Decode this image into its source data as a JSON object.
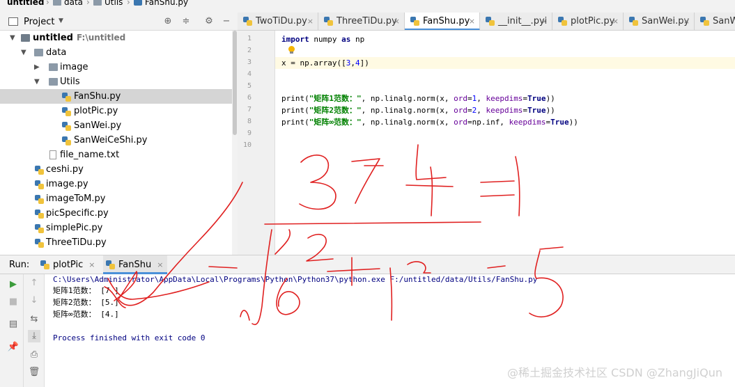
{
  "breadcrumb": [
    {
      "label": "untitled",
      "icon": "folder-icon",
      "bold": true
    },
    {
      "label": "data",
      "icon": "folder-icon"
    },
    {
      "label": "Utils",
      "icon": "folder-icon"
    },
    {
      "label": "FanShu.py",
      "icon": "python-file-icon"
    }
  ],
  "project": {
    "title": "Project",
    "tree": [
      {
        "label": "untitled",
        "path": "F:\\untitled",
        "type": "folder",
        "depth": 0,
        "expanded": true
      },
      {
        "label": "data",
        "type": "folder",
        "depth": 1,
        "expanded": true
      },
      {
        "label": "image",
        "type": "folder",
        "depth": 2,
        "expanded": false
      },
      {
        "label": "Utils",
        "type": "folder",
        "depth": 2,
        "expanded": true
      },
      {
        "label": "FanShu.py",
        "type": "py",
        "depth": 3,
        "selected": true
      },
      {
        "label": "plotPic.py",
        "type": "py",
        "depth": 3
      },
      {
        "label": "SanWei.py",
        "type": "py",
        "depth": 3
      },
      {
        "label": "SanWeiCeShi.py",
        "type": "py",
        "depth": 3
      },
      {
        "label": "file_name.txt",
        "type": "txt",
        "depth": 2
      },
      {
        "label": "ceshi.py",
        "type": "py",
        "depth": 1
      },
      {
        "label": "image.py",
        "type": "py",
        "depth": 1
      },
      {
        "label": "imageToM.py",
        "type": "py",
        "depth": 1
      },
      {
        "label": "picSpecific.py",
        "type": "py",
        "depth": 1
      },
      {
        "label": "simplePic.py",
        "type": "py",
        "depth": 1
      },
      {
        "label": "ThreeTiDu.py",
        "type": "py",
        "depth": 1
      }
    ]
  },
  "editor_tabs": [
    {
      "label": "TwoTiDu.py"
    },
    {
      "label": "ThreeTiDu.py"
    },
    {
      "label": "FanShu.py",
      "active": true
    },
    {
      "label": "__init__.pyi"
    },
    {
      "label": "plotPic.py"
    },
    {
      "label": "SanWei.py"
    },
    {
      "label": "SanW"
    }
  ],
  "editor": {
    "line_numbers": [
      "1",
      "2",
      "3",
      "4",
      "5",
      "6",
      "7",
      "8",
      "9",
      "10"
    ],
    "lines": {
      "l1_kw1": "import",
      "l1_mod": " numpy ",
      "l1_kw2": "as",
      "l1_alias": " np",
      "l3_a": "x = np.array([",
      "l3_n1": "3",
      "l3_comma": ",",
      "l3_n2": "4",
      "l3_b": "])",
      "l6_a": "print(",
      "l6_str": "\"矩阵1范数：\"",
      "l6_b": ", np.linalg.norm(x, ",
      "l6_p1": "ord",
      "l6_c": "=",
      "l6_n": "1",
      "l6_d": ", ",
      "l6_p2": "keepdims",
      "l6_e": "=",
      "l6_kw": "True",
      "l6_f": "))",
      "l7_a": "print(",
      "l7_str": "\"矩阵2范数：\"",
      "l7_b": ", np.linalg.norm(x, ",
      "l7_p1": "ord",
      "l7_c": "=",
      "l7_n": "2",
      "l7_d": ", ",
      "l7_p2": "keepdims",
      "l7_e": "=",
      "l7_kw": "True",
      "l7_f": "))",
      "l8_a": "print(",
      "l8_str": "\"矩阵∞范数：\"",
      "l8_b": ", np.linalg.norm(x, ",
      "l8_p1": "ord",
      "l8_c": "=np.inf, ",
      "l8_p2": "keepdims",
      "l8_e": "=",
      "l8_kw": "True",
      "l8_f": "))"
    }
  },
  "run": {
    "label": "Run:",
    "tabs": [
      {
        "label": "plotPic"
      },
      {
        "label": "FanShu",
        "active": true
      }
    ],
    "console": {
      "cmd": "C:\\Users\\Administrator\\AppData\\Local\\Programs\\Python\\Python37\\python.exe F:/untitled/data/Utils/FanShu.py",
      "out1": "矩阵1范数： [7.]",
      "out2": "矩阵2范数： [5.]",
      "out3": "矩阵∞范数： [4.]",
      "exit": "Process finished with exit code 0"
    }
  },
  "watermark": "CSDN @ZhangJiQun",
  "watermark2": "@稀土掘金技术社区"
}
